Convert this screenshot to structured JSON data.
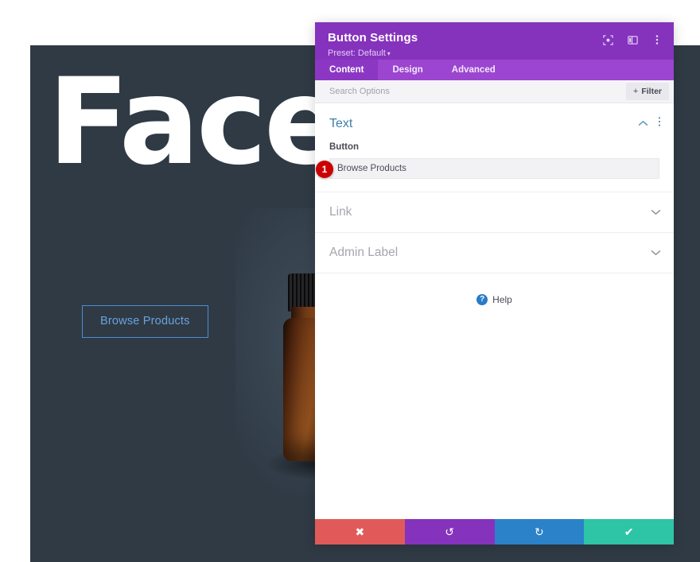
{
  "canvas": {
    "background_color": "#2f3a45",
    "heading": "Face",
    "cta_button_label": "Browse Products",
    "cta_border_color": "#4a8fd4",
    "cta_text_color": "#6ba3dd",
    "product_image_alt": "amber dropper bottle"
  },
  "panel": {
    "title": "Button Settings",
    "preset_label": "Preset: Default",
    "preset_caret": "▾",
    "header_icons": [
      {
        "name": "focus-target-icon"
      },
      {
        "name": "layout-panel-icon"
      },
      {
        "name": "kebab-menu-icon"
      }
    ],
    "tabs": [
      {
        "label": "Content",
        "active": true
      },
      {
        "label": "Design",
        "active": false
      },
      {
        "label": "Advanced",
        "active": false
      }
    ],
    "search": {
      "placeholder": "Search Options",
      "value": ""
    },
    "filter_button": {
      "label": "Filter",
      "plus": "+"
    },
    "sections": {
      "text": {
        "title": "Text",
        "expanded": true,
        "field": {
          "label": "Button",
          "value": "Browse Products",
          "placeholder": ""
        },
        "step_badge": "1"
      },
      "collapsed": [
        {
          "title": "Link"
        },
        {
          "title": "Admin Label"
        }
      ]
    },
    "help": {
      "icon_char": "?",
      "label": "Help"
    },
    "footer_actions": [
      {
        "name": "cancel-button",
        "glyph": "✖",
        "color": "#e05a5a"
      },
      {
        "name": "undo-button",
        "glyph": "↺",
        "color": "#8532bd"
      },
      {
        "name": "redo-button",
        "glyph": "↻",
        "color": "#2b82c9"
      },
      {
        "name": "save-button",
        "glyph": "✔",
        "color": "#2ec4a6"
      }
    ],
    "accent_color": "#8532bd",
    "tab_bar_color": "#9b45d0"
  }
}
